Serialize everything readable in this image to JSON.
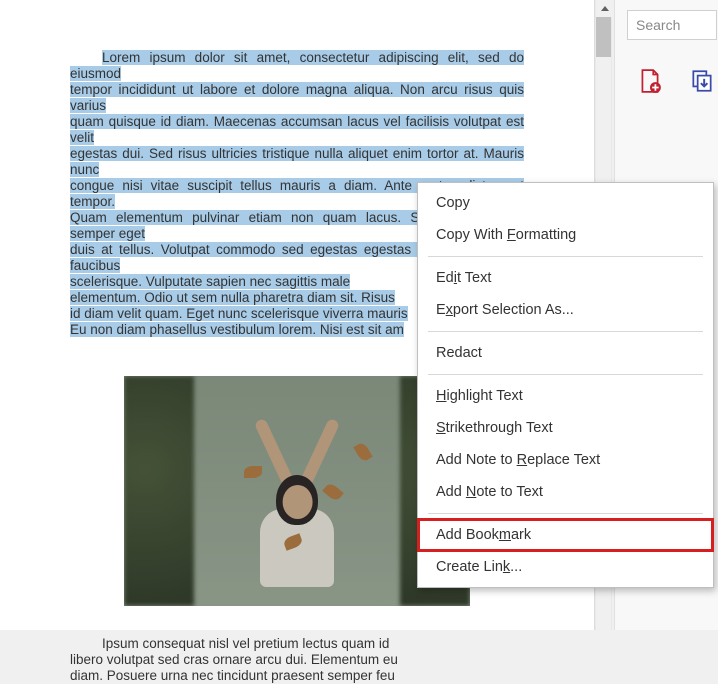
{
  "search_placeholder": "Search",
  "paragraph1": {
    "selected_lines": [
      "Lorem ipsum dolor sit amet, consectetur adipiscing elit, sed do eiusmod",
      "tempor incididunt ut labore et dolore magna aliqua. Non arcu risus quis varius",
      "quam quisque id diam. Maecenas accumsan lacus vel facilisis volutpat est velit",
      "egestas dui. Sed risus ultricies tristique nulla aliquet enim tortor at. Mauris nunc",
      "congue nisi vitae suscipit tellus mauris a diam. Ante metus dictum at tempor.",
      "Quam elementum pulvinar etiam non quam lacus. Scelerisque purus semper eget",
      "duis at tellus. Volutpat commodo sed egestas egestas fringilla phasellus faucibus",
      "scelerisque. Vulputate sapien nec sagittis male",
      "elementum. Odio ut sem nulla pharetra diam sit. Risus",
      "id diam velit quam. Eget nunc scelerisque viverra mauris",
      "Eu non diam phasellus vestibulum lorem. Nisi est sit am"
    ]
  },
  "paragraph2": {
    "line1": "Ipsum consequat nisl vel pretium lectus quam id",
    "line2": "libero volutpat sed cras ornare arcu dui. Elementum eu",
    "line3": "diam. Posuere urna nec tincidunt praesent semper feu"
  },
  "menu": {
    "copy": "Copy",
    "copy_fmt_pre": "Copy With ",
    "copy_fmt_u": "F",
    "copy_fmt_post": "ormatting",
    "edit_pre": "Ed",
    "edit_u": "i",
    "edit_post": "t Text",
    "export_pre": "E",
    "export_u": "x",
    "export_post": "port Selection As...",
    "redact": "Redact",
    "hl_u": "H",
    "hl_post": "ighlight Text",
    "strike_u": "S",
    "strike_post": "trikethrough Text",
    "addnote_r_pre": "Add Note to ",
    "addnote_r_u": "R",
    "addnote_r_post": "eplace Text",
    "addnote_pre": "Add ",
    "addnote_u": "N",
    "addnote_post": "ote to Text",
    "bookmark_pre": "Add Book",
    "bookmark_u": "m",
    "bookmark_post": "ark",
    "link_pre": "Create Lin",
    "link_u": "k",
    "link_post": "..."
  }
}
